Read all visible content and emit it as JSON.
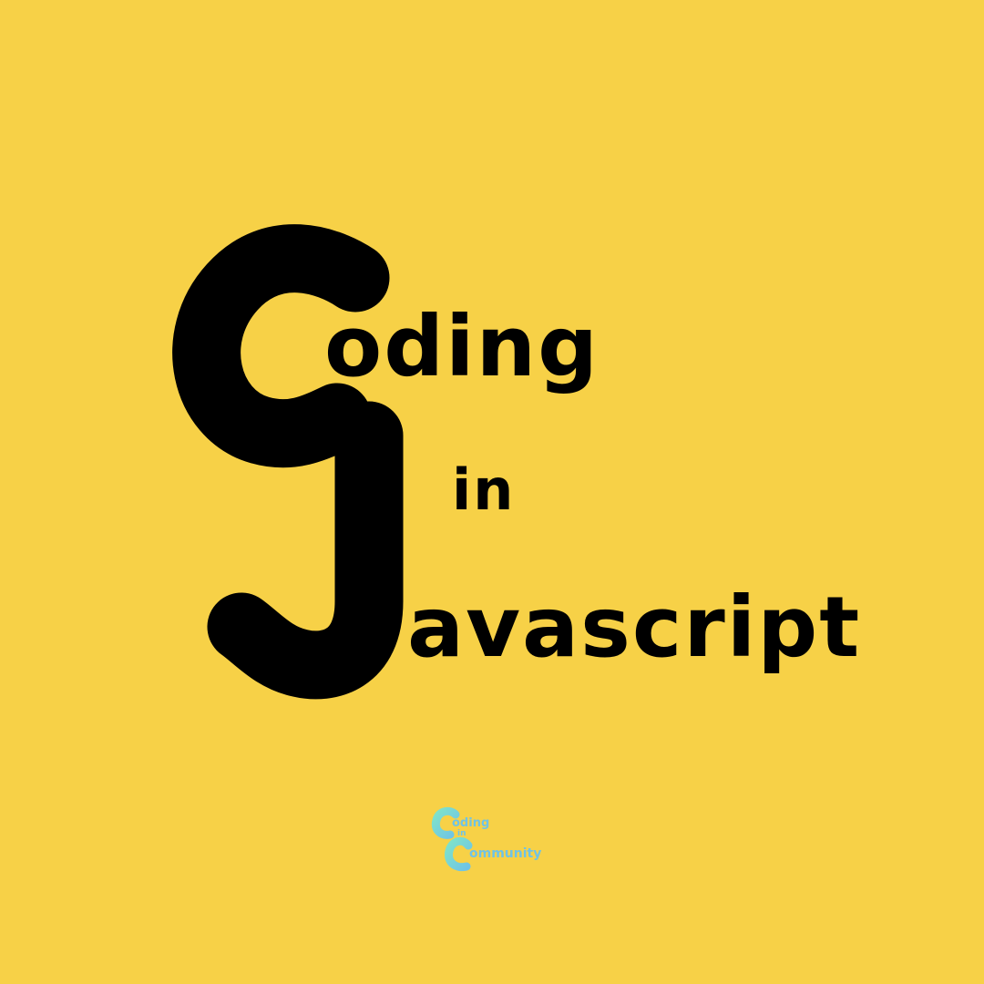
{
  "colors": {
    "background": "#F7D147",
    "text": "#000000",
    "logo_teal": "#7FE3C9",
    "logo_blue": "#6FC3E6"
  },
  "title": {
    "line1_rest": "oding",
    "line2": "in",
    "line3_rest": "avascript"
  },
  "logo": {
    "line1_rest": "oding",
    "line2": "in",
    "line3_rest": "ommunity"
  }
}
